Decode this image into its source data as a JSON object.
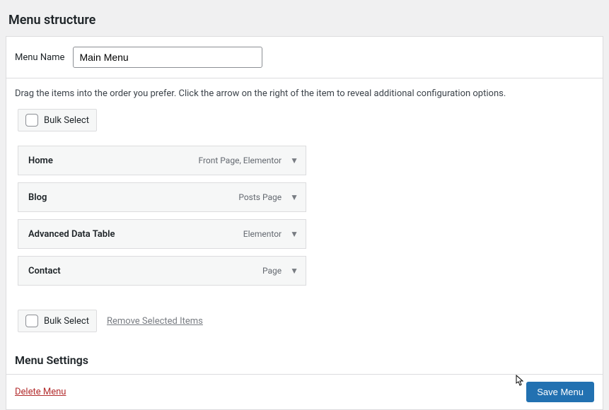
{
  "header": {
    "title": "Menu structure"
  },
  "menu_name": {
    "label": "Menu Name",
    "value": "Main Menu"
  },
  "instructions": "Drag the items into the order you prefer. Click the arrow on the right of the item to reveal additional configuration options.",
  "bulk_select": {
    "label": "Bulk Select"
  },
  "menu_items": [
    {
      "title": "Home",
      "type": "Front Page, Elementor"
    },
    {
      "title": "Blog",
      "type": "Posts Page"
    },
    {
      "title": "Advanced Data Table",
      "type": "Elementor"
    },
    {
      "title": "Contact",
      "type": "Page"
    }
  ],
  "remove_selected_label": "Remove Selected Items",
  "menu_settings": {
    "title": "Menu Settings"
  },
  "footer": {
    "delete_label": "Delete Menu",
    "save_label": "Save Menu"
  }
}
